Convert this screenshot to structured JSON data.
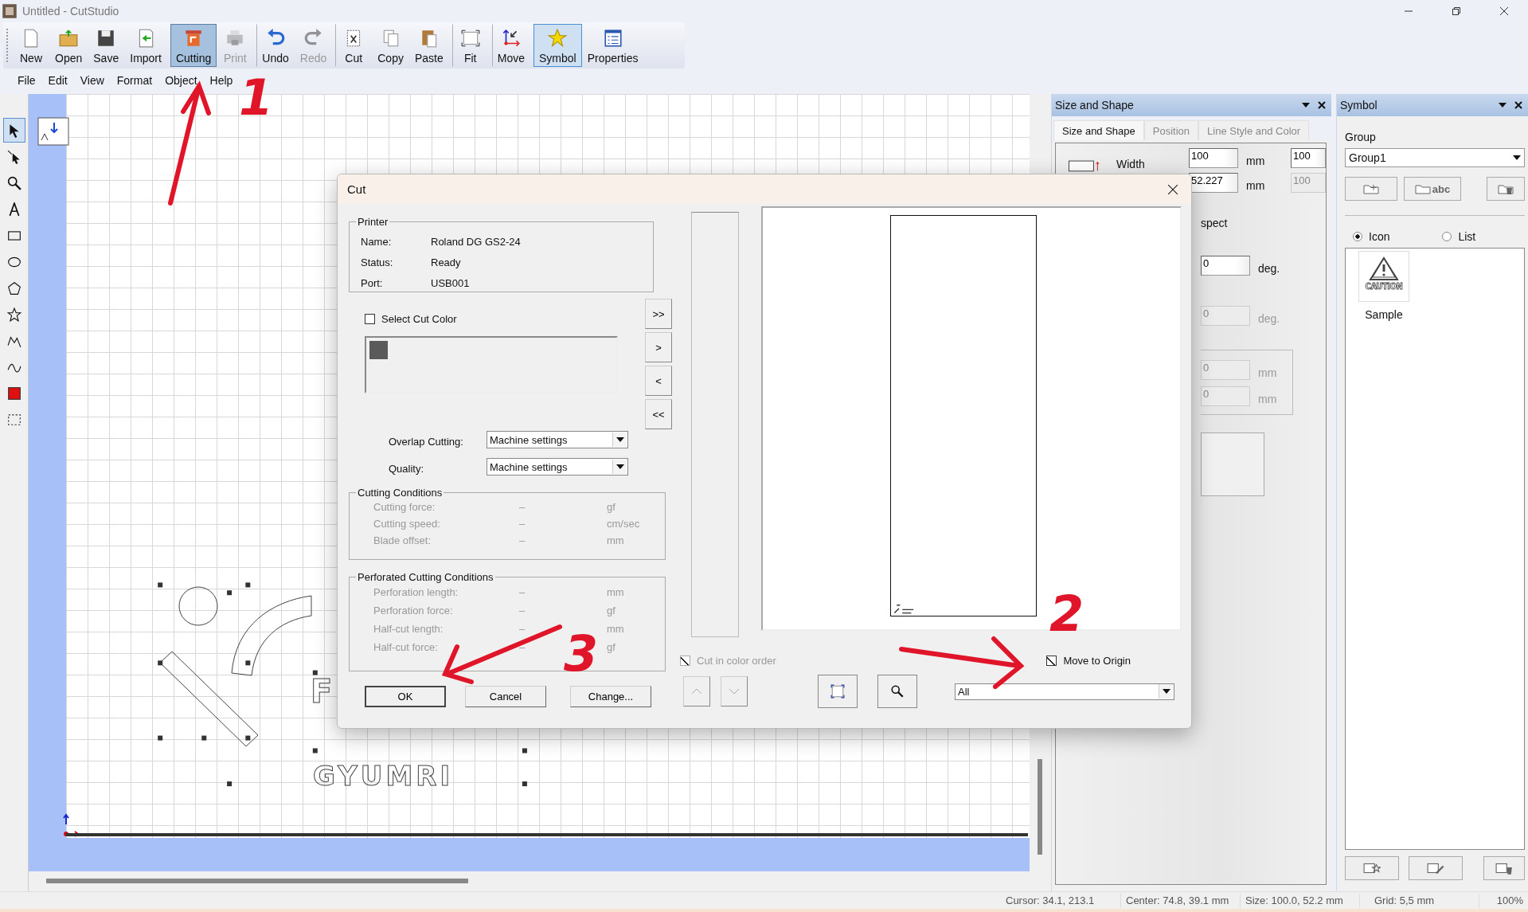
{
  "window": {
    "title": "Untitled - CutStudio"
  },
  "toolbar": [
    {
      "label": "New",
      "kind": "new",
      "selected": false,
      "disabled": false,
      "separator_before": false
    },
    {
      "label": "Open",
      "kind": "open",
      "selected": false,
      "disabled": false,
      "separator_before": false
    },
    {
      "label": "Save",
      "kind": "save",
      "selected": false,
      "disabled": false,
      "separator_before": false
    },
    {
      "label": "Import",
      "kind": "import",
      "selected": false,
      "disabled": false,
      "separator_before": false
    },
    {
      "label": "Cutting",
      "kind": "cutting",
      "selected": true,
      "disabled": false,
      "separator_before": true
    },
    {
      "label": "Print",
      "kind": "print",
      "selected": false,
      "disabled": true,
      "separator_before": false
    },
    {
      "label": "Undo",
      "kind": "undo",
      "selected": false,
      "disabled": false,
      "separator_before": true
    },
    {
      "label": "Redo",
      "kind": "redo",
      "selected": false,
      "disabled": true,
      "separator_before": false
    },
    {
      "label": "Cut",
      "kind": "cut",
      "selected": false,
      "disabled": false,
      "separator_before": true
    },
    {
      "label": "Copy",
      "kind": "copy",
      "selected": false,
      "disabled": false,
      "separator_before": false
    },
    {
      "label": "Paste",
      "kind": "paste",
      "selected": false,
      "disabled": false,
      "separator_before": false
    },
    {
      "label": "Fit",
      "kind": "fit",
      "selected": false,
      "disabled": false,
      "separator_before": true
    },
    {
      "label": "Move",
      "kind": "move",
      "selected": false,
      "disabled": false,
      "separator_before": true
    },
    {
      "label": "Symbol",
      "kind": "symbol",
      "selected": true,
      "disabled": false,
      "separator_before": true
    },
    {
      "label": "Properties",
      "kind": "properties",
      "selected": false,
      "disabled": false,
      "separator_before": false
    }
  ],
  "menu": [
    "File",
    "Edit",
    "View",
    "Format",
    "Object",
    "Help"
  ],
  "tools": [
    {
      "kind": "pointer",
      "selected": true
    },
    {
      "kind": "node",
      "selected": false
    },
    {
      "kind": "zoom",
      "selected": false
    },
    {
      "kind": "text",
      "selected": false
    },
    {
      "kind": "rectangle",
      "selected": false
    },
    {
      "kind": "ellipse",
      "selected": false
    },
    {
      "kind": "polygon",
      "selected": false
    },
    {
      "kind": "star",
      "selected": false
    },
    {
      "kind": "polyline",
      "selected": false
    },
    {
      "kind": "curve",
      "selected": false
    },
    {
      "kind": "fill",
      "selected": false
    },
    {
      "kind": "marquee",
      "selected": false
    }
  ],
  "canvas": {
    "texts": [
      {
        "text": "F"
      },
      {
        "text": "GYUMRI"
      }
    ]
  },
  "size_panel": {
    "title": "Size and Shape",
    "tabs": [
      {
        "label": "Size and Shape",
        "selected": true
      },
      {
        "label": "Position",
        "selected": false
      },
      {
        "label": "Line Style and Color",
        "selected": false
      }
    ],
    "width_label": "Width",
    "fields": [
      {
        "value": "100",
        "unit": "mm",
        "ratio": "100",
        "ratio_disabled": false
      },
      {
        "value": "52.227",
        "unit": "mm",
        "ratio": "100",
        "ratio_disabled": true
      }
    ],
    "aspect_text": "spect",
    "angle_fields": [
      {
        "value": "0",
        "unit": "deg.",
        "disabled": false
      },
      {
        "value": "0",
        "unit": "deg.",
        "disabled": true
      }
    ],
    "offset_fields": [
      {
        "value": "0",
        "unit": "mm",
        "disabled": true
      },
      {
        "value": "0",
        "unit": "mm",
        "disabled": true
      }
    ]
  },
  "symbol_panel": {
    "title": "Symbol",
    "group_label": "Group",
    "group_value": "Group1",
    "buttons": [
      {
        "kind": "new-folder"
      },
      {
        "kind": "rename",
        "label": "abc"
      },
      {
        "kind": "delete-folder"
      }
    ],
    "views": [
      {
        "label": "Icon",
        "selected": true
      },
      {
        "label": "List",
        "selected": false
      }
    ],
    "items": [
      {
        "label": "Sample",
        "art_text": "CAUTION"
      }
    ],
    "bottom_buttons": [
      {
        "kind": "add"
      },
      {
        "kind": "edit"
      },
      {
        "kind": "remove"
      }
    ]
  },
  "cut_dialog": {
    "title": "Cut",
    "printer": {
      "legend": "Printer",
      "rows": [
        {
          "label": "Name:",
          "value": "Roland DG GS2-24"
        },
        {
          "label": "Status:",
          "value": "Ready"
        },
        {
          "label": "Port:",
          "value": "USB001"
        }
      ]
    },
    "select_cut_color": {
      "label": "Select Cut Color",
      "checked": false
    },
    "colors": [
      {
        "color": "#5a5a5a"
      }
    ],
    "move_buttons": [
      ">>",
      ">",
      "<",
      "<<"
    ],
    "overlap": {
      "label": "Overlap Cutting:",
      "value": "Machine settings"
    },
    "quality": {
      "label": "Quality:",
      "value": "Machine settings"
    },
    "cutting_conditions": {
      "legend": "Cutting Conditions",
      "disabled": true,
      "rows": [
        {
          "label": "Cutting force:",
          "value": "–",
          "unit": "gf"
        },
        {
          "label": "Cutting speed:",
          "value": "–",
          "unit": "cm/sec"
        },
        {
          "label": "Blade offset:",
          "value": "–",
          "unit": "mm"
        }
      ]
    },
    "perforated": {
      "legend": "Perforated Cutting Conditions",
      "disabled": true,
      "rows": [
        {
          "label": "Perforation length:",
          "value": "–",
          "unit": "mm"
        },
        {
          "label": "Perforation  force:",
          "value": "–",
          "unit": "gf"
        },
        {
          "label": "Half-cut length:",
          "value": "–",
          "unit": "mm"
        },
        {
          "label": "Half-cut force:",
          "value": "–",
          "unit": "gf"
        }
      ]
    },
    "buttons": [
      {
        "label": "OK",
        "default": true
      },
      {
        "label": "Cancel",
        "default": false
      },
      {
        "label": "Change...",
        "default": false
      }
    ],
    "cut_in_color_order": {
      "label": "Cut in color order",
      "checked": true,
      "disabled": true
    },
    "move_to_origin": {
      "label": "Move to Origin",
      "checked": true,
      "disabled": false
    },
    "order_buttons": [
      {
        "kind": "up",
        "disabled": true
      },
      {
        "kind": "down",
        "disabled": true
      }
    ],
    "view_buttons": [
      {
        "kind": "fit"
      },
      {
        "kind": "zoom"
      }
    ],
    "range": {
      "value": "All"
    }
  },
  "status_bar": [
    "Cursor: 34.1, 213.1",
    "Center: 74.8, 39.1 mm",
    "Size: 100.0, 52.2 mm",
    "Grid: 5,5 mm",
    "100%"
  ],
  "annotations": [
    {
      "label": "1"
    },
    {
      "label": "2"
    },
    {
      "label": "3"
    }
  ]
}
